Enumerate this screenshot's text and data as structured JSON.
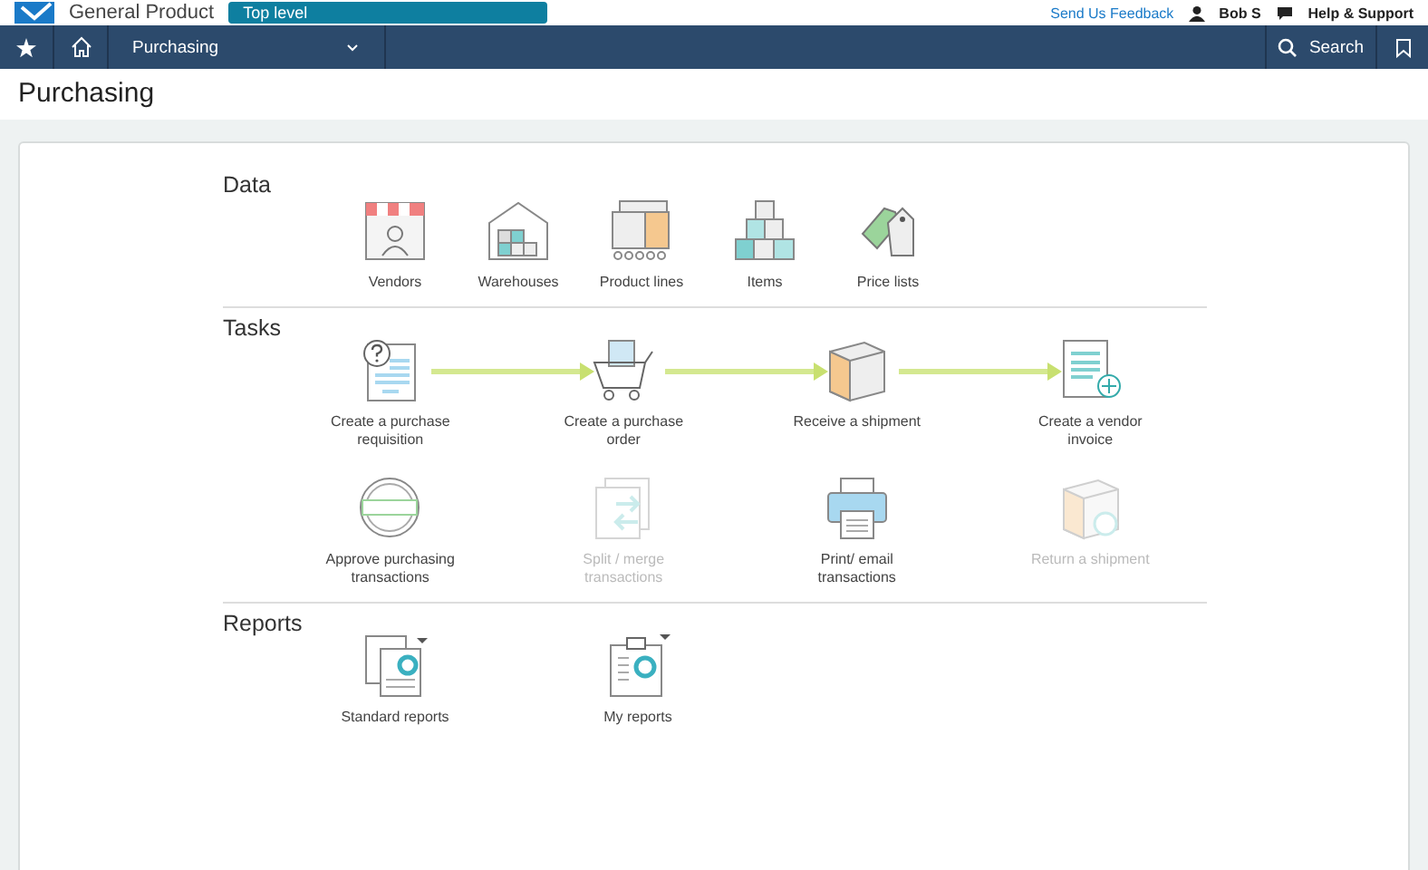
{
  "header": {
    "app_name": "General Product",
    "level_badge": "Top level",
    "feedback_link": "Send Us Feedback",
    "user": "Bob S",
    "help": "Help & Support"
  },
  "nav": {
    "module": "Purchasing",
    "search": "Search"
  },
  "page_title": "Purchasing",
  "data": {
    "title": "Data",
    "items": [
      {
        "label": "Vendors",
        "kind": "vendors",
        "disabled": false
      },
      {
        "label": "Warehouses",
        "kind": "warehouses",
        "disabled": false
      },
      {
        "label": "Product lines",
        "kind": "product-lines",
        "disabled": false
      },
      {
        "label": "Items",
        "kind": "items",
        "disabled": false
      },
      {
        "label": "Price lists",
        "kind": "price-lists",
        "disabled": false
      }
    ]
  },
  "tasks": {
    "title": "Tasks",
    "flow_items": [
      {
        "label": "Create a purchase requisition",
        "kind": "requisition",
        "disabled": false
      },
      {
        "label": "Create a purchase order",
        "kind": "cart",
        "disabled": false
      },
      {
        "label": "Receive a shipment",
        "kind": "box",
        "disabled": false
      },
      {
        "label": "Create a vendor invoice",
        "kind": "invoice",
        "disabled": false
      }
    ],
    "more_items": [
      {
        "label": "Approve purchasing transactions",
        "kind": "approved",
        "disabled": false
      },
      {
        "label": "Split / merge transactions",
        "kind": "split",
        "disabled": true
      },
      {
        "label": "Print/ email transactions",
        "kind": "printer",
        "disabled": false
      },
      {
        "label": "Return a shipment",
        "kind": "return",
        "disabled": true
      }
    ]
  },
  "reports": {
    "title": "Reports",
    "items": [
      {
        "label": "Standard reports",
        "kind": "standard-reports",
        "disabled": false
      },
      {
        "label": "My reports",
        "kind": "my-reports",
        "disabled": false
      }
    ]
  }
}
